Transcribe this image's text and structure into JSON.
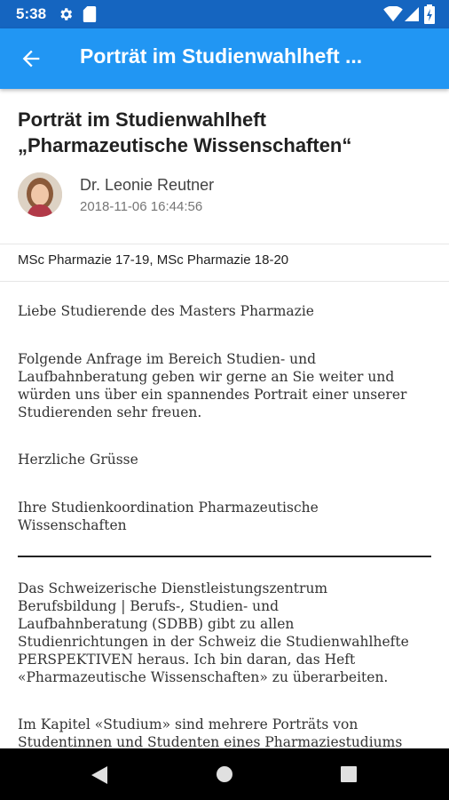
{
  "status_bar": {
    "time": "5:38"
  },
  "app_bar": {
    "title": "Porträt im Studienwahlheft ..."
  },
  "post": {
    "title_line1": "Porträt im Studienwahlheft",
    "title_line2": "„Pharmazeutische Wissenschaften“",
    "author": "Dr. Leonie Reutner",
    "date": "2018-11-06 16:44:56",
    "tags": "MSc Pharmazie 17-19, MSc Pharmazie 18-20"
  },
  "body": {
    "greeting": "Liebe Studierende des Masters Pharmazie",
    "para1_lines": [
      "Folgende Anfrage im Bereich Studien- und",
      "Laufbahnberatung geben wir gerne an Sie weiter und",
      "würden uns über ein spannendes Portrait einer unserer",
      "Studierenden sehr freuen."
    ],
    "regards": "Herzliche Grüsse",
    "signature_lines": [
      "Ihre Studienkoordination Pharmazeutische",
      "Wissenschaften"
    ],
    "para2_lines": [
      "Das Schweizerische Dienstleistungszentrum",
      "Berufsbildung | Berufs-, Studien- und",
      "Laufbahnberatung (SDBB) gibt zu allen",
      "Studienrichtungen in der Schweiz die Studienwahlhefte",
      "PERSPEKTIVEN heraus. Ich bin daran, das Heft",
      "«Pharmazeutische Wissenschaften» zu überarbeiten."
    ],
    "para3_lines": [
      "Im Kapitel «Studium» sind mehrere Porträts von",
      "Studentinnen und Studenten eines Pharmaziestudiums"
    ]
  },
  "colors": {
    "status_bar": "#1565c0",
    "app_bar": "#2196f3",
    "nav_bar": "#000000"
  }
}
